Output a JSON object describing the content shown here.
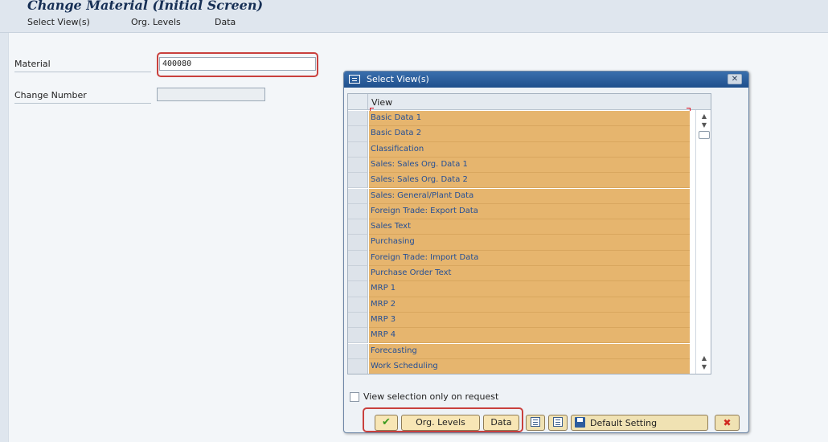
{
  "window": {
    "title": "Change Material (Initial Screen)"
  },
  "menu": {
    "items": [
      "Select View(s)",
      "Org. Levels",
      "Data"
    ]
  },
  "form": {
    "material_label": "Material",
    "material_value": "400080",
    "change_number_label": "Change Number",
    "change_number_value": ""
  },
  "dialog": {
    "title": "Select View(s)",
    "column_header": "View",
    "views": [
      "Basic Data 1",
      "Basic Data 2",
      "Classification",
      "Sales: Sales Org. Data 1",
      "Sales: Sales Org. Data 2",
      "Sales: General/Plant Data",
      "Foreign Trade: Export Data",
      "Sales Text",
      "Purchasing",
      "Foreign Trade: Import Data",
      "Purchase Order Text",
      "MRP 1",
      "MRP 2",
      "MRP 3",
      "MRP 4",
      "Forecasting",
      "Work Scheduling"
    ],
    "checkbox_label": "View selection only on request",
    "buttons": {
      "ok_icon": "checkmark-icon",
      "org_levels": "Org. Levels",
      "data": "Data",
      "select_all_icon": "select-all-icon",
      "deselect_all_icon": "deselect-all-icon",
      "default_setting": "Default Setting",
      "cancel_icon": "cancel-icon"
    }
  },
  "colors": {
    "selected_row": "#e6b56e",
    "row_text": "#244f95",
    "dialog_title": "#1f4f8c",
    "highlight": "#c9403d"
  }
}
